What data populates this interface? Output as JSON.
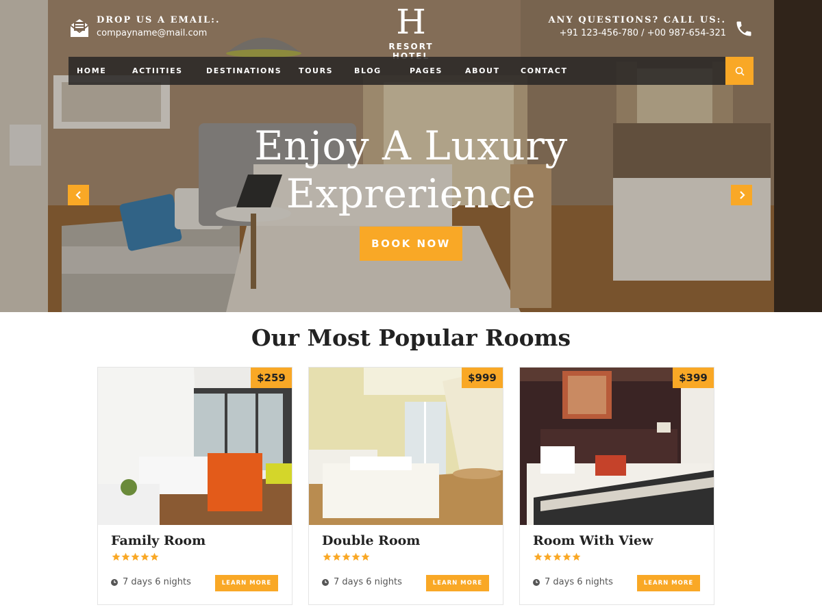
{
  "header": {
    "email_title": "DROP US A EMAIL:.",
    "email_value": "compayname@mail.com",
    "phone_title": "ANY QUESTIONS? CALL US:.",
    "phone_value": "+91 123-456-780 / +00 987-654-321",
    "logo_letter": "H",
    "logo_name": "RESORT HOTEL",
    "icons": {
      "email": "mail-icon",
      "phone": "phone-icon",
      "search": "search-icon"
    }
  },
  "nav": {
    "items": [
      "HOME",
      "ACTIITIES",
      "DESTINATIONS",
      "TOURS",
      "BLOG",
      "PAGES",
      "ABOUT",
      "CONTACT"
    ]
  },
  "hero": {
    "title_line1": "Enjoy A Luxury",
    "title_line2": "Exprerience",
    "button": "BOOK NOW"
  },
  "rooms": {
    "section_title": "Our Most Popular Rooms",
    "items": [
      {
        "name": "Family Room",
        "price": "$259",
        "rating": 5,
        "duration": "7 days 6 nights",
        "button": "LEARN MORE"
      },
      {
        "name": "Double Room",
        "price": "$999",
        "rating": 5,
        "duration": "7 days 6 nights",
        "button": "LEARN MORE"
      },
      {
        "name": "Room With View",
        "price": "$399",
        "rating": 5,
        "duration": "7 days 6 nights",
        "button": "LEARN MORE"
      }
    ]
  },
  "colors": {
    "accent": "#f9a826",
    "nav_bg": "#282624",
    "text_dark": "#222222"
  }
}
